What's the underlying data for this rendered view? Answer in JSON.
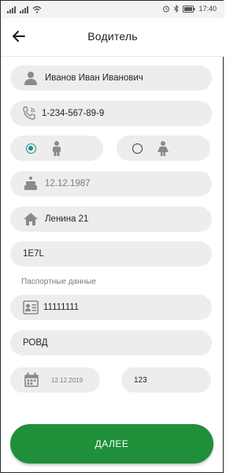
{
  "status_bar": {
    "time": "17:40"
  },
  "header": {
    "title": "Водитель"
  },
  "form": {
    "full_name": "Иванов Иван Иванович",
    "phone": "1-234-567-89-9",
    "birth_date": "12.12.1987",
    "address": "Ленина 21",
    "code": "1E7L",
    "passport_section_label": "Паспортные данные",
    "passport_number": "11111111",
    "issued_by": "РОВД",
    "issue_date": "12.12.2019",
    "issue_code": "123",
    "gender": {
      "selected": "male"
    }
  },
  "actions": {
    "next_label": "ДАЛЕЕ"
  },
  "colors": {
    "accent_green": "#1f8f3a",
    "radio_teal": "#1d8f8a",
    "field_bg": "#ededed",
    "icon_gray": "#8a8a8a"
  }
}
